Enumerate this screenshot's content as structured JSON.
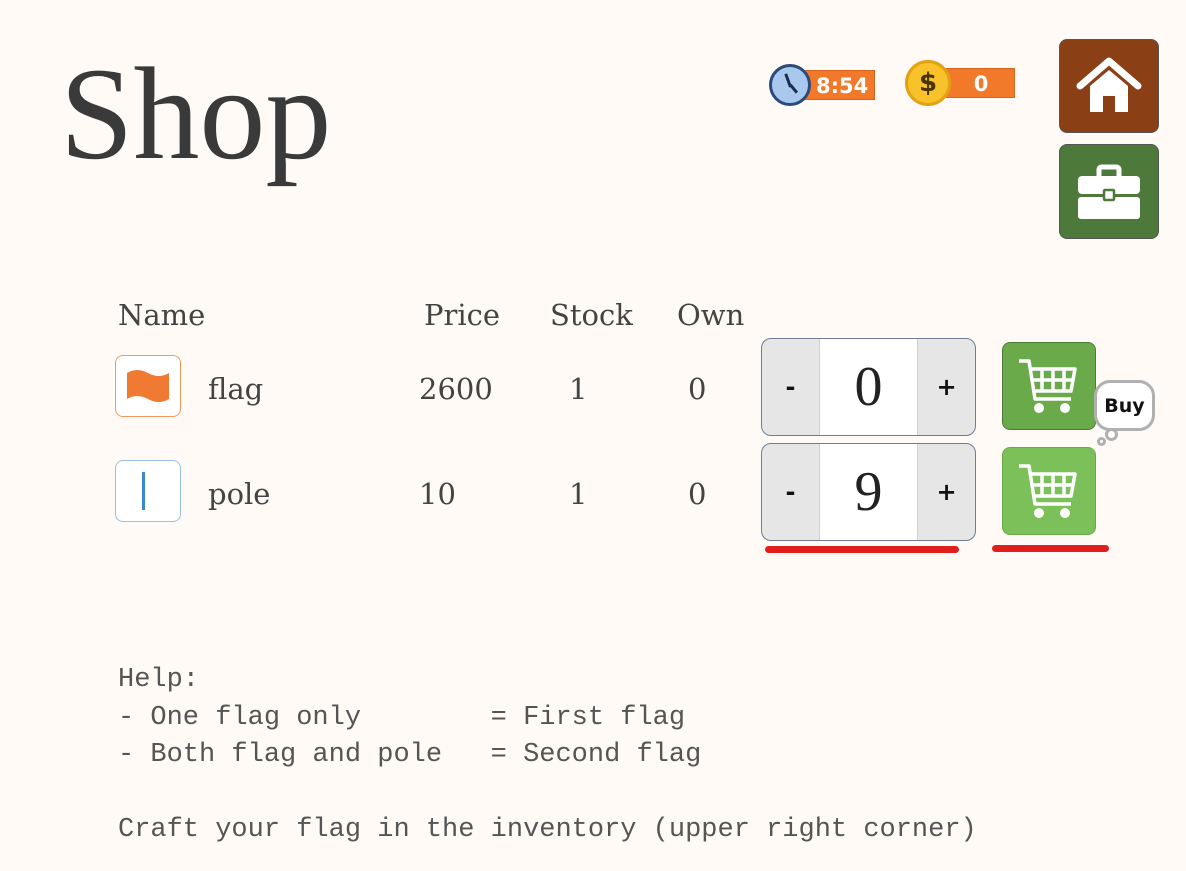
{
  "page": {
    "title": "Shop"
  },
  "hud": {
    "time": "8:54",
    "coins": "0",
    "clock_icon": "clock-icon",
    "coin_icon": "coin-icon",
    "coin_symbol": "$"
  },
  "nav": {
    "home_icon": "home-icon",
    "inventory_icon": "briefcase-icon"
  },
  "table": {
    "headers": {
      "name": "Name",
      "price": "Price",
      "stock": "Stock",
      "own": "Own"
    },
    "rows": [
      {
        "icon": "flag-icon",
        "name": "flag",
        "price": "2600",
        "stock": "1",
        "own": "0",
        "quantity": "0",
        "decrement": "-",
        "increment": "+"
      },
      {
        "icon": "pole-icon",
        "name": "pole",
        "price": "10",
        "stock": "1",
        "own": "0",
        "quantity": "9",
        "decrement": "-",
        "increment": "+"
      }
    ]
  },
  "tooltip": {
    "buy": "Buy"
  },
  "help": {
    "heading": "Help:",
    "line1": "- One flag only        = First flag",
    "line2": "- Both flag and pole   = Second flag",
    "line3": "Craft your flag in the inventory (upper right corner)"
  },
  "colors": {
    "accent_orange": "#f2782a",
    "home_button": "#8b3f14",
    "inventory_button": "#4d7a3a",
    "cart_button": "#6aaa4a",
    "underline_red": "#e01e1e",
    "background": "#fffaf5"
  }
}
